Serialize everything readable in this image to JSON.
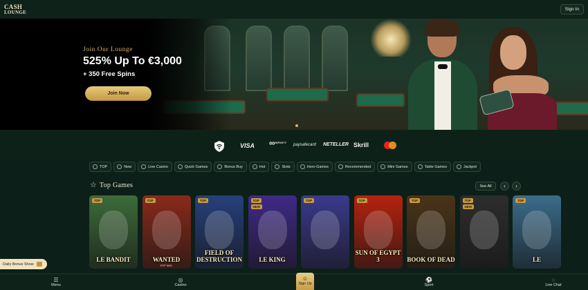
{
  "header": {
    "logo_line1": "CASH",
    "logo_line2": "LOUNGE",
    "signin_label": "Sign In"
  },
  "hero": {
    "kicker": "Join Our Lounge",
    "title": "525% Up To €3,000",
    "subtitle": "+ 350 Free Spins",
    "cta_label": "Join Now"
  },
  "payments": {
    "visa": "VISA",
    "infinity_caption": "MiFINITY",
    "paysafe": "paysafecard",
    "neteller": "NETELLER",
    "skrill": "Skrill"
  },
  "categories": [
    {
      "label": "TOP",
      "icon": "star-icon"
    },
    {
      "label": "New",
      "icon": "new-icon"
    },
    {
      "label": "Live Casino",
      "icon": "live-icon"
    },
    {
      "label": "Quick Games",
      "icon": "bolt-icon"
    },
    {
      "label": "Bonus Buy",
      "icon": "cart-icon"
    },
    {
      "label": "Hot",
      "icon": "flame-icon"
    },
    {
      "label": "Slots",
      "icon": "slot-icon"
    },
    {
      "label": "Hero Games",
      "icon": "hero-icon"
    },
    {
      "label": "Recommended",
      "icon": "thumb-icon"
    },
    {
      "label": "Mini Games",
      "icon": "dice-icon"
    },
    {
      "label": "Table Games",
      "icon": "table-icon"
    },
    {
      "label": "Jackpot",
      "icon": "jackpot-icon"
    }
  ],
  "top_games": {
    "title": "Top Games",
    "see_all": "See All",
    "prev": "‹",
    "next": "›",
    "games": [
      {
        "name": "LE BANDIT",
        "badges": [
          "TOP"
        ],
        "sub": "",
        "bg": "#3d6b3a"
      },
      {
        "name": "WANTED",
        "badges": [
          "TOP"
        ],
        "sub": "RTP 96%",
        "bg": "#8a2a1a"
      },
      {
        "name": "FIELD OF DESTRUCTION",
        "badges": [
          "TOP"
        ],
        "sub": "",
        "bg": "#26407a"
      },
      {
        "name": "LE KING",
        "badges": [
          "TOP",
          "NEW"
        ],
        "sub": "",
        "bg": "#3f2a86"
      },
      {
        "name": "",
        "badges": [
          "TOP"
        ],
        "sub": "",
        "bg": "#3a3a8c"
      },
      {
        "name": "SUN OF EGYPT 3",
        "badges": [
          "TOP"
        ],
        "sub": "",
        "bg": "#b5230e"
      },
      {
        "name": "BOOK OF DEAD",
        "badges": [
          "TOP"
        ],
        "sub": "",
        "bg": "#4a3418"
      },
      {
        "name": "",
        "badges": [
          "TOP",
          "NEW"
        ],
        "sub": "",
        "bg": "#2d2d2d"
      },
      {
        "name": "LE",
        "badges": [
          "TOP"
        ],
        "sub": "",
        "bg": "#3b6c8a"
      }
    ]
  },
  "daily_bonus": "Daily Bonus Show",
  "bottom_nav": {
    "menu": "Menu",
    "casino": "Casino",
    "signup": "Sign Up",
    "sport": "Sport",
    "livechat": "Live Chat"
  }
}
